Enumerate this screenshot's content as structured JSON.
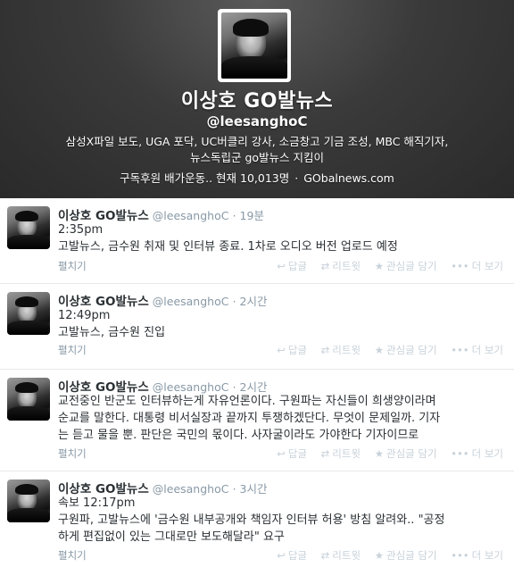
{
  "profile": {
    "name": "이상호 GO발뉴스",
    "handle": "@leesanghoC",
    "bio_line1": "삼성X파일 보도, UGA 포닥, UC버클리 강사, 소금창고 기금 조성, MBC 해직기자,",
    "bio_line2": "뉴스독립군 go발뉴스 지킴이",
    "meta_left": "구독후원 배가운동.. 현재 10,013명",
    "meta_sep": "·",
    "website": "GObalnews.com"
  },
  "actions": {
    "reply": "답글",
    "retweet": "리트윗",
    "favorite": "관심글 담기",
    "more": "더 보기",
    "expand": "펼치기",
    "reply_icon": "reply-icon",
    "retweet_icon": "retweet-icon",
    "favorite_icon": "star-icon",
    "more_icon": "dots-icon"
  },
  "tweets": [
    {
      "name": "이상호 GO발뉴스",
      "handle": "@leesanghoC",
      "time": "· 19분",
      "line1": "2:35pm",
      "line2": "고발뉴스, 금수원 취재 및 인터뷰 종료. 1차로 오디오 버전 업로드 예정",
      "line3": ""
    },
    {
      "name": "이상호 GO발뉴스",
      "handle": "@leesanghoC",
      "time": "· 2시간",
      "line1": "12:49pm",
      "line2": "고발뉴스, 금수원 진입",
      "line3": ""
    },
    {
      "name": "이상호 GO발뉴스",
      "handle": "@leesanghoC",
      "time": "· 2시간",
      "line1": "교전중인 반군도 인터뷰하는게 자유언론이다. 구원파는 자신들이 희생양이라며",
      "line2": "순교를 말한다. 대통령 비서실장과 끝까지 투쟁하겠단다. 무엇이 문제일까. 기자",
      "line3": "는 듣고 물을 뿐. 판단은 국민의 몫이다. 사자굴이라도 가야한다 기자이므로"
    },
    {
      "name": "이상호 GO발뉴스",
      "handle": "@leesanghoC",
      "time": "· 3시간",
      "line1": "속보 12:17pm",
      "line2": "구원파, 고발뉴스에 '금수원 내부공개와 책임자 인터뷰 허용' 방침 알려와.. \"공정",
      "line3": "하게 편집없이 있는 그대로만 보도해달라\" 요구"
    }
  ]
}
